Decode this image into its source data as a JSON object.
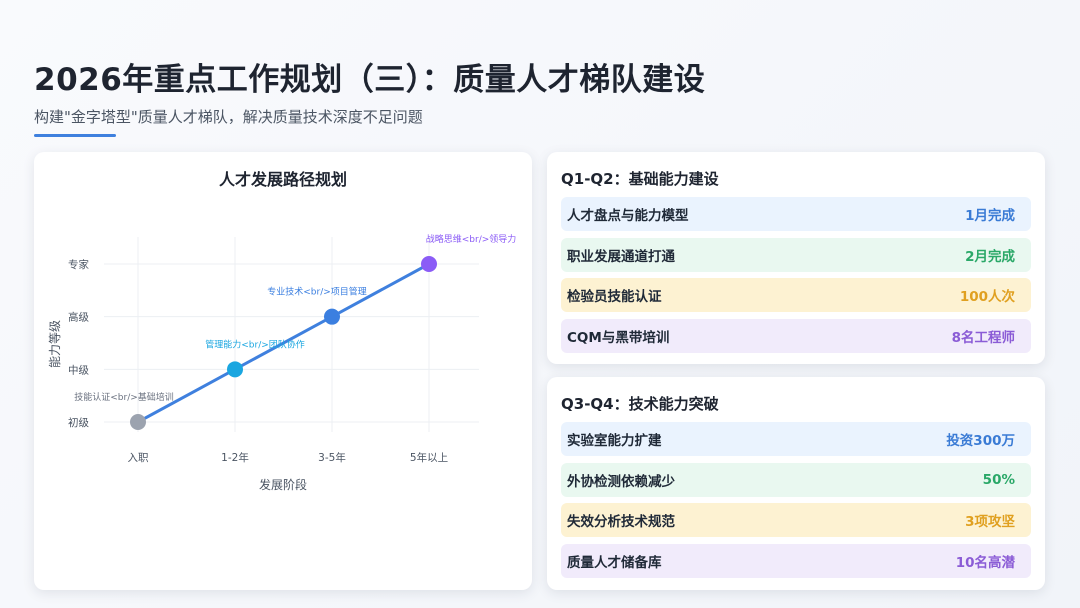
{
  "header": {
    "title": "2026年重点工作规划（三）：质量人才梯队建设",
    "subtitle": "构建\"金字塔型\"质量人才梯队，解决质量技术深度不足问题"
  },
  "chart_data": {
    "type": "line",
    "title": "人才发展路径规划",
    "xlabel": "发展阶段",
    "ylabel": "能力等级",
    "categories": [
      "入职",
      "1-2年",
      "3-5年",
      "5年以上"
    ],
    "y_levels": [
      "初级",
      "中级",
      "高级",
      "专家"
    ],
    "series": [
      {
        "values": [
          1,
          2,
          3,
          4
        ],
        "point_labels": [
          "技能认证<br/>基础培训",
          "管理能力<br/>团队协作",
          "专业技术<br/>项目管理",
          "战略思维<br/>领导力"
        ],
        "point_colors": [
          "#9ca3af",
          "#1aa6e0",
          "#3b7fe0",
          "#8b5cf6"
        ],
        "line_color": "#3f80de"
      }
    ],
    "grid": true
  },
  "phases": [
    {
      "title": "Q1-Q2：基础能力建设",
      "items": [
        {
          "label": "人才盘点与能力模型",
          "value": "1月完成",
          "tone": "blue"
        },
        {
          "label": "职业发展通道打通",
          "value": "2月完成",
          "tone": "green"
        },
        {
          "label": "检验员技能认证",
          "value": "100人次",
          "tone": "yellow"
        },
        {
          "label": "CQM与黑带培训",
          "value": "8名工程师",
          "tone": "purple"
        }
      ]
    },
    {
      "title": "Q3-Q4：技术能力突破",
      "items": [
        {
          "label": "实验室能力扩建",
          "value": "投资300万",
          "tone": "blue"
        },
        {
          "label": "外协检测依赖减少",
          "value": "50%",
          "tone": "green"
        },
        {
          "label": "失效分析技术规范",
          "value": "3项攻坚",
          "tone": "yellow"
        },
        {
          "label": "质量人才储备库",
          "value": "10名高潜",
          "tone": "purple"
        }
      ]
    }
  ]
}
